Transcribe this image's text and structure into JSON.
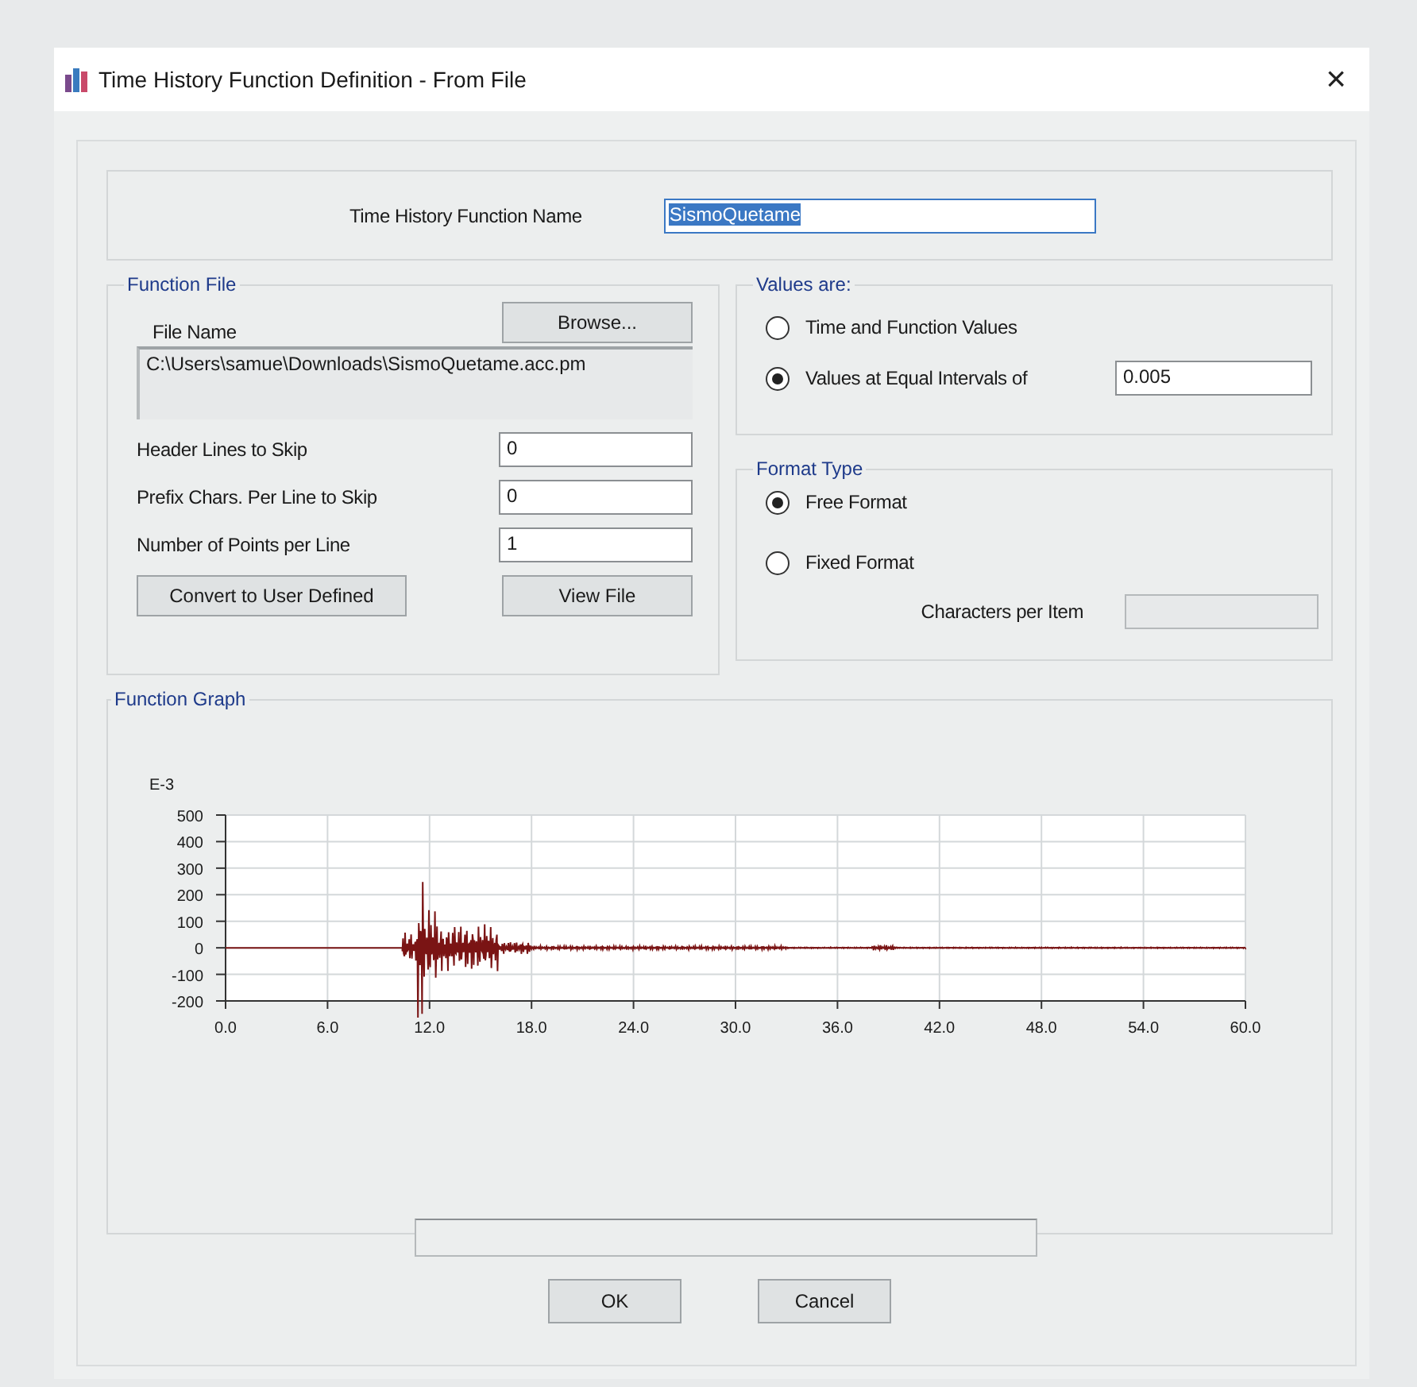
{
  "window": {
    "title": "Time History Function Definition  - From File",
    "close": "×"
  },
  "function_name": {
    "label": "Time History Function Name",
    "value": "SismoQuetame",
    "text_selected": true
  },
  "function_file": {
    "title": "Function File",
    "file_name_label": "File Name",
    "browse": "Browse...",
    "path": "C:\\Users\\samue\\Downloads\\SismoQuetame.acc.pm",
    "fields": [
      {
        "label": "Header Lines to Skip",
        "value": "0"
      },
      {
        "label": "Prefix Chars. Per Line to Skip",
        "value": "0"
      },
      {
        "label": "Number of Points per Line",
        "value": "1"
      }
    ],
    "buttons": [
      "Convert to User Defined",
      "View File"
    ]
  },
  "values_are": {
    "title": "Values are:",
    "options": [
      {
        "label": "Time and Function Values",
        "selected": false
      },
      {
        "label": "Values at Equal Intervals of",
        "selected": true
      }
    ],
    "interval": "0.005"
  },
  "format_type": {
    "title": "Format Type",
    "options": [
      {
        "label": "Free Format",
        "selected": true
      },
      {
        "label": "Fixed Format",
        "selected": false
      }
    ],
    "chars_label": "Characters per Item"
  },
  "graph": {
    "title": "Function Graph",
    "unit": "E-3",
    "y_labels": [
      "500",
      "400",
      "300",
      "200",
      "100",
      "0",
      "-100",
      "-200"
    ],
    "x_labels": [
      "0.0",
      "6.0",
      "12.0",
      "18.0",
      "24.0",
      "30.0",
      "36.0",
      "42.0",
      "48.0",
      "54.0",
      "60.0"
    ]
  },
  "buttons": [
    "OK",
    "Cancel"
  ]
}
